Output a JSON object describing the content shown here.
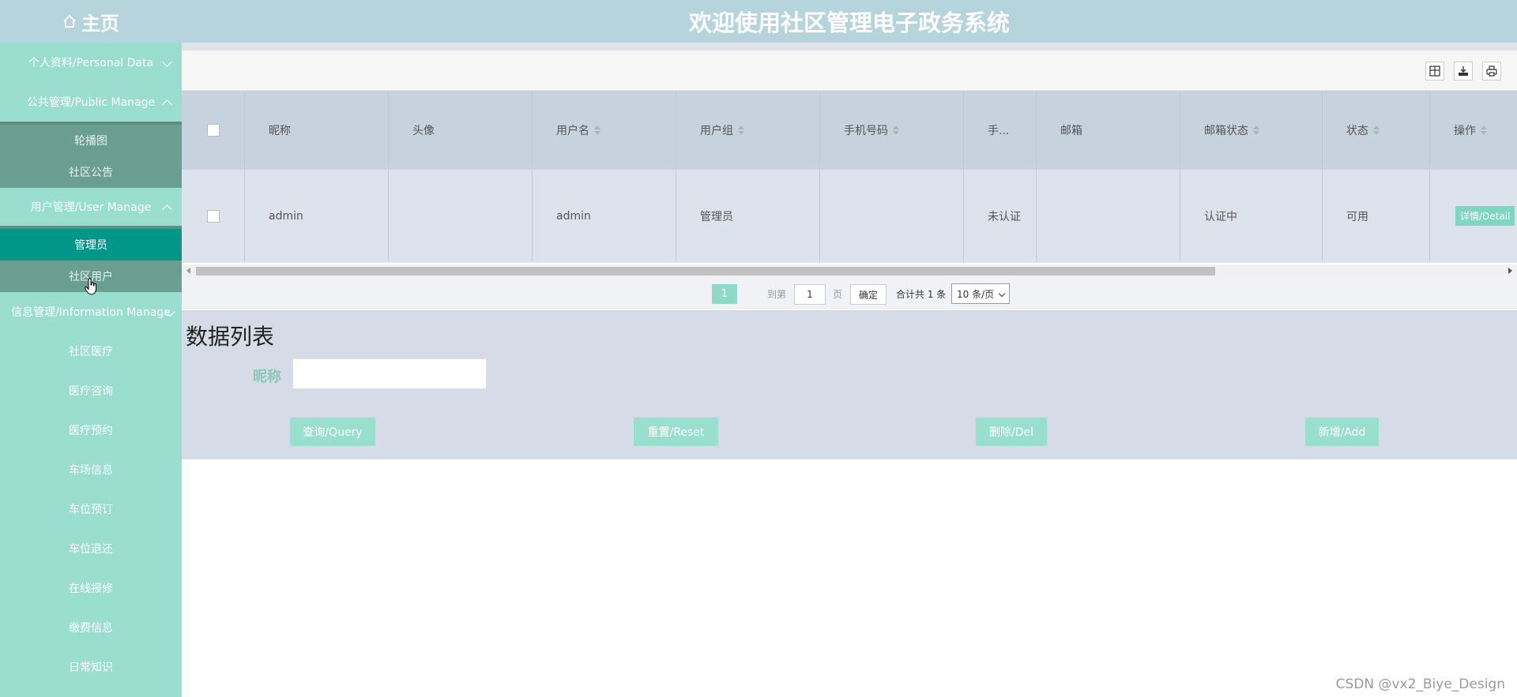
{
  "header": {
    "home_label": "主页",
    "title": "欢迎使用社区管理电子政务系统"
  },
  "sidebar": {
    "groups": [
      {
        "label": "个人资料/Personal Data"
      },
      {
        "label": "公共管理/Public Manage",
        "items": [
          "轮播图",
          "社区公告"
        ]
      },
      {
        "label": "用户管理/User Manage",
        "items": [
          "管理员",
          "社区用户"
        ],
        "active": "管理员"
      },
      {
        "label": "信息管理/Information Manage",
        "items": [
          "社区医疗",
          "医疗咨询",
          "医疗预约",
          "车场信息",
          "车位预订",
          "车位退还",
          "在线报修",
          "缴费信息",
          "日常知识"
        ]
      }
    ]
  },
  "toolbar": {
    "icons": [
      "columns-icon",
      "export-icon",
      "print-icon"
    ]
  },
  "table": {
    "columns": [
      "昵称",
      "头像",
      "用户名",
      "用户组",
      "手机号码",
      "手...",
      "邮箱",
      "邮箱状态",
      "状态",
      "操作"
    ],
    "rows": [
      {
        "nickname": "admin",
        "avatar": "",
        "username": "admin",
        "group": "管理员",
        "phone": "",
        "phone_status": "未认证",
        "email": "",
        "email_status": "认证中",
        "status": "可用",
        "action": "详情/Detail"
      }
    ]
  },
  "pagination": {
    "current": "1",
    "goto_label": "到第",
    "page_input": "1",
    "page_unit": "页",
    "confirm": "确定",
    "total": "合计共 1 条",
    "page_size": "10 条/页"
  },
  "search": {
    "section_title": "数据列表",
    "field_label": "昵称",
    "field_value": "",
    "buttons": {
      "query": "查询/Query",
      "reset": "重置/Reset",
      "delete": "删除/Del",
      "add": "新增/Add"
    }
  },
  "watermark": "CSDN @vx2_Biye_Design",
  "colors": {
    "sidebar_bg": "#99decf",
    "active_item": "#009688",
    "header_bg": "#b6d4dc",
    "button_bg": "#99dfcd"
  }
}
